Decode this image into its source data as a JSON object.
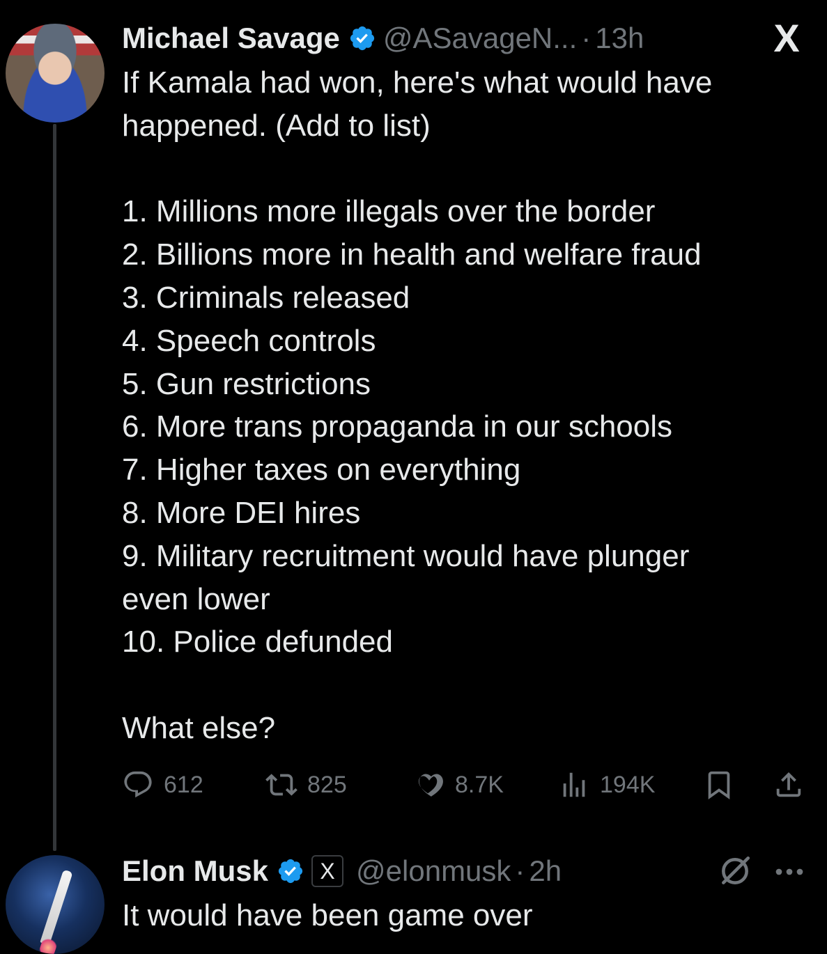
{
  "tweet1": {
    "name": "Michael Savage",
    "handle": "@ASavageN...",
    "time": "13h",
    "lines": [
      "If Kamala had won, here's what would have",
      "happened. (Add to list)",
      "",
      "1. Millions more illegals over the border",
      "2. Billions more in health and welfare fraud",
      "3. Criminals released",
      "4. Speech controls",
      "5. Gun restrictions",
      "6. More trans propaganda in our schools",
      "7. Higher taxes on everything",
      "8. More DEI hires",
      "9. Military recruitment would have plunger",
      "even lower",
      "10. Police defunded",
      "",
      "What else?"
    ],
    "stats": {
      "replies": "612",
      "reposts": "825",
      "likes": "8.7K",
      "views": "194K"
    }
  },
  "tweet2": {
    "name": "Elon Musk",
    "affiliation_badge": "X",
    "handle": "@elonmusk",
    "time": "2h",
    "text": "It would have been game over"
  },
  "header": {
    "platform_logo": "X"
  },
  "separator": "·",
  "colors": {
    "background": "#000000",
    "text": "#e7e9ea",
    "muted": "#71767b",
    "verified": "#1d9bf0"
  },
  "icons": [
    "verified-badge-icon",
    "x-logo-icon",
    "reply-icon",
    "repost-icon",
    "like-icon",
    "views-icon",
    "bookmark-icon",
    "share-icon",
    "grok-icon",
    "more-icon"
  ]
}
